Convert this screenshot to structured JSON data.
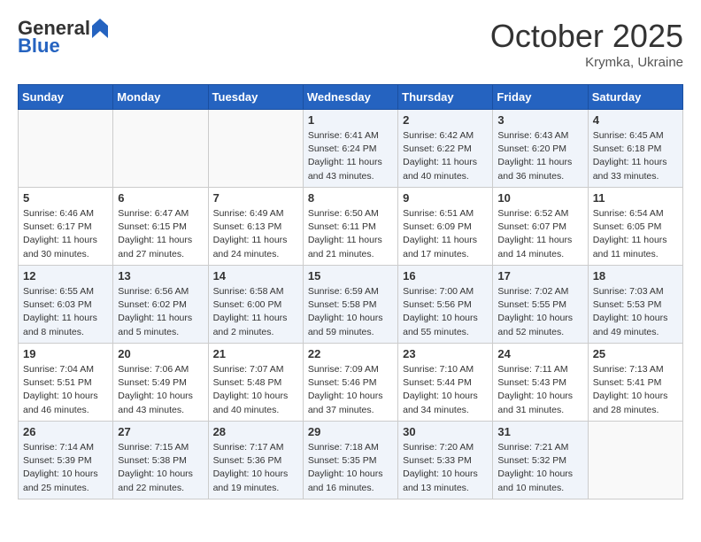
{
  "header": {
    "logo_general": "General",
    "logo_blue": "Blue",
    "month": "October 2025",
    "location": "Krymka, Ukraine"
  },
  "weekdays": [
    "Sunday",
    "Monday",
    "Tuesday",
    "Wednesday",
    "Thursday",
    "Friday",
    "Saturday"
  ],
  "weeks": [
    [
      {
        "day": "",
        "info": ""
      },
      {
        "day": "",
        "info": ""
      },
      {
        "day": "",
        "info": ""
      },
      {
        "day": "1",
        "info": "Sunrise: 6:41 AM\nSunset: 6:24 PM\nDaylight: 11 hours\nand 43 minutes."
      },
      {
        "day": "2",
        "info": "Sunrise: 6:42 AM\nSunset: 6:22 PM\nDaylight: 11 hours\nand 40 minutes."
      },
      {
        "day": "3",
        "info": "Sunrise: 6:43 AM\nSunset: 6:20 PM\nDaylight: 11 hours\nand 36 minutes."
      },
      {
        "day": "4",
        "info": "Sunrise: 6:45 AM\nSunset: 6:18 PM\nDaylight: 11 hours\nand 33 minutes."
      }
    ],
    [
      {
        "day": "5",
        "info": "Sunrise: 6:46 AM\nSunset: 6:17 PM\nDaylight: 11 hours\nand 30 minutes."
      },
      {
        "day": "6",
        "info": "Sunrise: 6:47 AM\nSunset: 6:15 PM\nDaylight: 11 hours\nand 27 minutes."
      },
      {
        "day": "7",
        "info": "Sunrise: 6:49 AM\nSunset: 6:13 PM\nDaylight: 11 hours\nand 24 minutes."
      },
      {
        "day": "8",
        "info": "Sunrise: 6:50 AM\nSunset: 6:11 PM\nDaylight: 11 hours\nand 21 minutes."
      },
      {
        "day": "9",
        "info": "Sunrise: 6:51 AM\nSunset: 6:09 PM\nDaylight: 11 hours\nand 17 minutes."
      },
      {
        "day": "10",
        "info": "Sunrise: 6:52 AM\nSunset: 6:07 PM\nDaylight: 11 hours\nand 14 minutes."
      },
      {
        "day": "11",
        "info": "Sunrise: 6:54 AM\nSunset: 6:05 PM\nDaylight: 11 hours\nand 11 minutes."
      }
    ],
    [
      {
        "day": "12",
        "info": "Sunrise: 6:55 AM\nSunset: 6:03 PM\nDaylight: 11 hours\nand 8 minutes."
      },
      {
        "day": "13",
        "info": "Sunrise: 6:56 AM\nSunset: 6:02 PM\nDaylight: 11 hours\nand 5 minutes."
      },
      {
        "day": "14",
        "info": "Sunrise: 6:58 AM\nSunset: 6:00 PM\nDaylight: 11 hours\nand 2 minutes."
      },
      {
        "day": "15",
        "info": "Sunrise: 6:59 AM\nSunset: 5:58 PM\nDaylight: 10 hours\nand 59 minutes."
      },
      {
        "day": "16",
        "info": "Sunrise: 7:00 AM\nSunset: 5:56 PM\nDaylight: 10 hours\nand 55 minutes."
      },
      {
        "day": "17",
        "info": "Sunrise: 7:02 AM\nSunset: 5:55 PM\nDaylight: 10 hours\nand 52 minutes."
      },
      {
        "day": "18",
        "info": "Sunrise: 7:03 AM\nSunset: 5:53 PM\nDaylight: 10 hours\nand 49 minutes."
      }
    ],
    [
      {
        "day": "19",
        "info": "Sunrise: 7:04 AM\nSunset: 5:51 PM\nDaylight: 10 hours\nand 46 minutes."
      },
      {
        "day": "20",
        "info": "Sunrise: 7:06 AM\nSunset: 5:49 PM\nDaylight: 10 hours\nand 43 minutes."
      },
      {
        "day": "21",
        "info": "Sunrise: 7:07 AM\nSunset: 5:48 PM\nDaylight: 10 hours\nand 40 minutes."
      },
      {
        "day": "22",
        "info": "Sunrise: 7:09 AM\nSunset: 5:46 PM\nDaylight: 10 hours\nand 37 minutes."
      },
      {
        "day": "23",
        "info": "Sunrise: 7:10 AM\nSunset: 5:44 PM\nDaylight: 10 hours\nand 34 minutes."
      },
      {
        "day": "24",
        "info": "Sunrise: 7:11 AM\nSunset: 5:43 PM\nDaylight: 10 hours\nand 31 minutes."
      },
      {
        "day": "25",
        "info": "Sunrise: 7:13 AM\nSunset: 5:41 PM\nDaylight: 10 hours\nand 28 minutes."
      }
    ],
    [
      {
        "day": "26",
        "info": "Sunrise: 7:14 AM\nSunset: 5:39 PM\nDaylight: 10 hours\nand 25 minutes."
      },
      {
        "day": "27",
        "info": "Sunrise: 7:15 AM\nSunset: 5:38 PM\nDaylight: 10 hours\nand 22 minutes."
      },
      {
        "day": "28",
        "info": "Sunrise: 7:17 AM\nSunset: 5:36 PM\nDaylight: 10 hours\nand 19 minutes."
      },
      {
        "day": "29",
        "info": "Sunrise: 7:18 AM\nSunset: 5:35 PM\nDaylight: 10 hours\nand 16 minutes."
      },
      {
        "day": "30",
        "info": "Sunrise: 7:20 AM\nSunset: 5:33 PM\nDaylight: 10 hours\nand 13 minutes."
      },
      {
        "day": "31",
        "info": "Sunrise: 7:21 AM\nSunset: 5:32 PM\nDaylight: 10 hours\nand 10 minutes."
      },
      {
        "day": "",
        "info": ""
      }
    ]
  ]
}
